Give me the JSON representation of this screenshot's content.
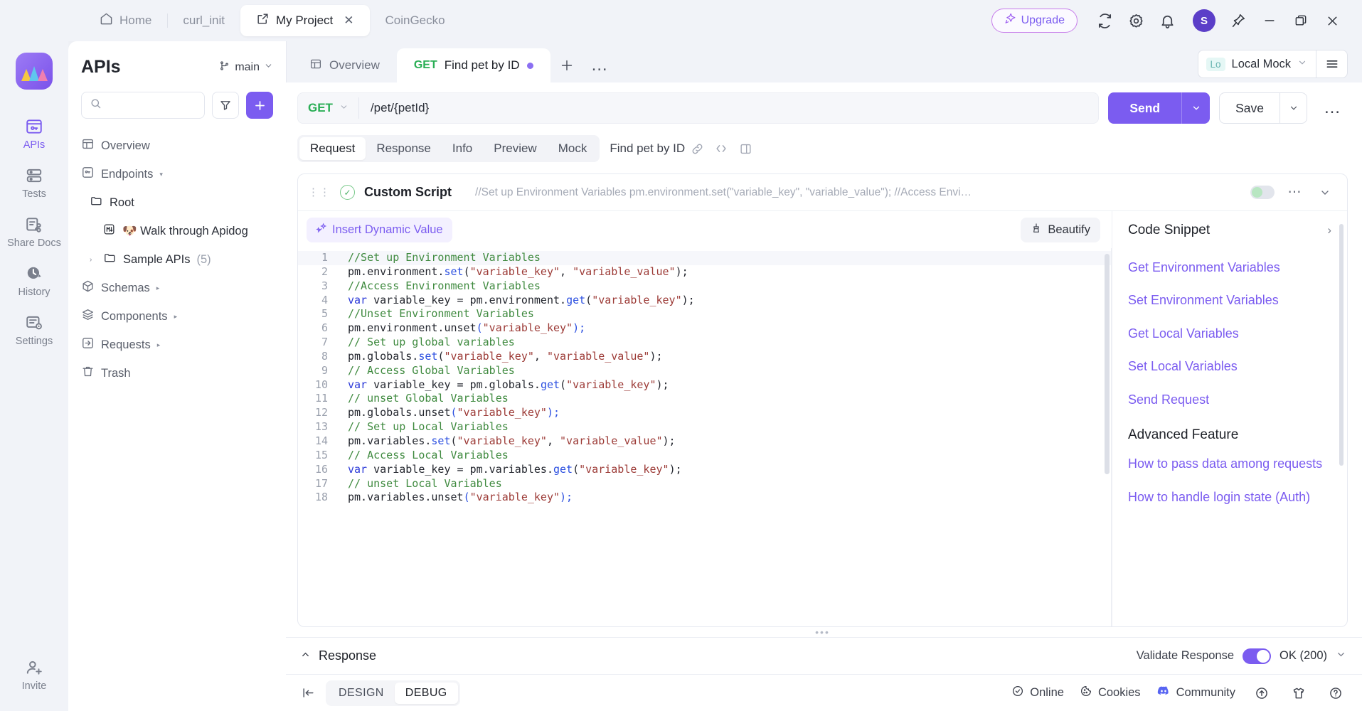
{
  "window": {
    "tabs": [
      {
        "label": "Home",
        "icon": "home-icon",
        "active": false
      },
      {
        "label": "curl_init",
        "icon": "",
        "active": false
      },
      {
        "label": "My Project",
        "icon": "external-link-icon",
        "active": true,
        "close": "✕"
      },
      {
        "label": "CoinGecko",
        "icon": "",
        "active": false
      }
    ],
    "upgrade_label": "Upgrade",
    "avatar_initial": "S",
    "controls": {
      "minimize": "—",
      "maximize": "restore-icon",
      "close": "✕"
    }
  },
  "rail": {
    "items": [
      {
        "label": "APIs",
        "icon": "apis-icon",
        "active": true
      },
      {
        "label": "Tests",
        "icon": "tests-icon",
        "active": false
      },
      {
        "label": "Share Docs",
        "icon": "share-docs-icon",
        "active": false
      },
      {
        "label": "History",
        "icon": "history-icon",
        "active": false
      },
      {
        "label": "Settings",
        "icon": "settings-icon",
        "active": false
      },
      {
        "label": "Invite",
        "icon": "invite-icon",
        "active": false
      }
    ],
    "watermark": "Apidog"
  },
  "sidebar": {
    "title": "APIs",
    "branch": "main",
    "search_placeholder": "",
    "filter_icon": "filter-icon",
    "add_label": "+",
    "tree": [
      {
        "label": "Overview",
        "icon": "overview-icon",
        "level": 0,
        "caret": "",
        "count": "",
        "tri": ""
      },
      {
        "label": "Endpoints",
        "icon": "endpoints-icon",
        "level": 0,
        "caret": "",
        "count": "",
        "tri": "▾"
      },
      {
        "label": "Root",
        "icon": "folder-icon",
        "level": 1,
        "caret": "",
        "count": "",
        "tri": ""
      },
      {
        "label": "🐶 Walk through Apidog",
        "icon": "markdown-icon",
        "level": 2,
        "caret": "",
        "count": "",
        "tri": ""
      },
      {
        "label": "Sample APIs",
        "icon": "folder-icon",
        "level": 1,
        "caret": "›",
        "count": "(5)",
        "tri": ""
      },
      {
        "label": "Schemas",
        "icon": "schemas-icon",
        "level": 0,
        "caret": "",
        "count": "",
        "tri": "▸"
      },
      {
        "label": "Components",
        "icon": "components-icon",
        "level": 0,
        "caret": "",
        "count": "",
        "tri": "▸"
      },
      {
        "label": "Requests",
        "icon": "requests-icon",
        "level": 0,
        "caret": "",
        "count": "",
        "tri": "▸"
      },
      {
        "label": "Trash",
        "icon": "trash-icon",
        "level": 0,
        "caret": "",
        "count": "",
        "tri": ""
      }
    ]
  },
  "main_tabs": {
    "overview_label": "Overview",
    "request_tab": {
      "method": "GET",
      "label": "Find pet by ID",
      "modified": true
    },
    "plus_label": "＋",
    "more_label": "…"
  },
  "environment": {
    "badge": "Lo",
    "name": "Local Mock",
    "hamburger_icon": "hamburger-icon"
  },
  "url_row": {
    "method": "GET",
    "path": "/pet/{petId}",
    "send_label": "Send",
    "save_label": "Save",
    "more_label": "…"
  },
  "subtabs": {
    "items": [
      {
        "label": "Request",
        "active": true
      },
      {
        "label": "Response",
        "active": false
      },
      {
        "label": "Info",
        "active": false
      },
      {
        "label": "Preview",
        "active": false
      },
      {
        "label": "Mock",
        "active": false
      }
    ],
    "endpoint_name": "Find pet by ID",
    "icons": [
      "link-icon",
      "code-icon",
      "split-view-icon"
    ]
  },
  "script": {
    "name": "Custom Script",
    "preview": "//Set up Environment Variables pm.environment.set(\"variable_key\", \"variable_value\"); //Access Envi…",
    "enabled_toggle": "off",
    "insert_dynamic_value": "Insert Dynamic Value",
    "beautify": "Beautify",
    "lines": [
      {
        "n": 1,
        "tokens": [
          {
            "t": "//Set up Environment Variables",
            "c": "cm"
          }
        ]
      },
      {
        "n": 2,
        "tokens": [
          {
            "t": "pm.environment.",
            "c": "cpl"
          },
          {
            "t": "set",
            "c": "cfn"
          },
          {
            "t": "(",
            "c": "cpl"
          },
          {
            "t": "\"variable_key\"",
            "c": "cstr"
          },
          {
            "t": ", ",
            "c": "cpl"
          },
          {
            "t": "\"variable_value\"",
            "c": "cstr"
          },
          {
            "t": ");",
            "c": "cpl"
          }
        ]
      },
      {
        "n": 3,
        "tokens": [
          {
            "t": "//Access Environment Variables",
            "c": "cm"
          }
        ]
      },
      {
        "n": 4,
        "tokens": [
          {
            "t": "var",
            "c": "ckw"
          },
          {
            "t": " variable_key = pm.environment.",
            "c": "cpl"
          },
          {
            "t": "get",
            "c": "cfn"
          },
          {
            "t": "(",
            "c": "cpl"
          },
          {
            "t": "\"variable_key\"",
            "c": "cstr"
          },
          {
            "t": ");",
            "c": "cpl"
          }
        ]
      },
      {
        "n": 5,
        "tokens": [
          {
            "t": "//Unset Environment Variables",
            "c": "cm"
          }
        ]
      },
      {
        "n": 6,
        "tokens": [
          {
            "t": "pm.environment.",
            "c": "cpl"
          },
          {
            "t": "unset",
            "c": "cpl"
          },
          {
            "t": "(",
            "c": "cfn"
          },
          {
            "t": "\"variable_key\"",
            "c": "cstr"
          },
          {
            "t": ");",
            "c": "cfn"
          }
        ]
      },
      {
        "n": 7,
        "tokens": [
          {
            "t": "// Set up global variables",
            "c": "cm"
          }
        ]
      },
      {
        "n": 8,
        "tokens": [
          {
            "t": "pm.globals.",
            "c": "cpl"
          },
          {
            "t": "set",
            "c": "cfn"
          },
          {
            "t": "(",
            "c": "cpl"
          },
          {
            "t": "\"variable_key\"",
            "c": "cstr"
          },
          {
            "t": ", ",
            "c": "cpl"
          },
          {
            "t": "\"variable_value\"",
            "c": "cstr"
          },
          {
            "t": ");",
            "c": "cpl"
          }
        ]
      },
      {
        "n": 9,
        "tokens": [
          {
            "t": "// Access Global Variables",
            "c": "cm"
          }
        ]
      },
      {
        "n": 10,
        "tokens": [
          {
            "t": "var",
            "c": "ckw"
          },
          {
            "t": " variable_key = pm.globals.",
            "c": "cpl"
          },
          {
            "t": "get",
            "c": "cfn"
          },
          {
            "t": "(",
            "c": "cpl"
          },
          {
            "t": "\"variable_key\"",
            "c": "cstr"
          },
          {
            "t": ");",
            "c": "cpl"
          }
        ]
      },
      {
        "n": 11,
        "tokens": [
          {
            "t": "// unset Global Variables",
            "c": "cm"
          }
        ]
      },
      {
        "n": 12,
        "tokens": [
          {
            "t": "pm.globals.",
            "c": "cpl"
          },
          {
            "t": "unset",
            "c": "cpl"
          },
          {
            "t": "(",
            "c": "cfn"
          },
          {
            "t": "\"variable_key\"",
            "c": "cstr"
          },
          {
            "t": ");",
            "c": "cfn"
          }
        ]
      },
      {
        "n": 13,
        "tokens": [
          {
            "t": "// Set up Local Variables",
            "c": "cm"
          }
        ]
      },
      {
        "n": 14,
        "tokens": [
          {
            "t": "pm.variables.",
            "c": "cpl"
          },
          {
            "t": "set",
            "c": "cfn"
          },
          {
            "t": "(",
            "c": "cpl"
          },
          {
            "t": "\"variable_key\"",
            "c": "cstr"
          },
          {
            "t": ", ",
            "c": "cpl"
          },
          {
            "t": "\"variable_value\"",
            "c": "cstr"
          },
          {
            "t": ");",
            "c": "cpl"
          }
        ]
      },
      {
        "n": 15,
        "tokens": [
          {
            "t": "// Access Local Variables",
            "c": "cm"
          }
        ]
      },
      {
        "n": 16,
        "tokens": [
          {
            "t": "var",
            "c": "ckw"
          },
          {
            "t": " variable_key = pm.variables.",
            "c": "cpl"
          },
          {
            "t": "get",
            "c": "cfn"
          },
          {
            "t": "(",
            "c": "cpl"
          },
          {
            "t": "\"variable_key\"",
            "c": "cstr"
          },
          {
            "t": ");",
            "c": "cpl"
          }
        ]
      },
      {
        "n": 17,
        "tokens": [
          {
            "t": "// unset Local Variables",
            "c": "cm"
          }
        ]
      },
      {
        "n": 18,
        "tokens": [
          {
            "t": "pm.variables.",
            "c": "cpl"
          },
          {
            "t": "unset",
            "c": "cpl"
          },
          {
            "t": "(",
            "c": "cfn"
          },
          {
            "t": "\"variable_key\"",
            "c": "cstr"
          },
          {
            "t": ");",
            "c": "cfn"
          }
        ]
      }
    ]
  },
  "snippet_panel": {
    "title": "Code Snippet",
    "expand_icon": "chevron-right-icon",
    "links": [
      "Get Environment Variables",
      "Set Environment Variables",
      "Get Local Variables",
      "Set Local Variables",
      "Send Request"
    ],
    "group_title": "Advanced Feature",
    "advanced_links": [
      "How to pass data among requests",
      "How to handle login state (Auth)"
    ]
  },
  "response_bar": {
    "collapse_icon": "chevron-up-icon",
    "label": "Response",
    "validate_label": "Validate Response",
    "validate_on": true,
    "status": "OK (200)"
  },
  "statusbar": {
    "collapse_icon": "collapse-left-icon",
    "modes": [
      {
        "label": "DESIGN",
        "active": false
      },
      {
        "label": "DEBUG",
        "active": true
      }
    ],
    "items": [
      {
        "label": "Online",
        "icon": "online-icon"
      },
      {
        "label": "Cookies",
        "icon": "cookie-icon"
      },
      {
        "label": "Community",
        "icon": "discord-icon"
      }
    ],
    "trailing_icons": [
      "upload-icon",
      "shirt-icon",
      "help-icon"
    ]
  },
  "colors": {
    "accent": "#7b5cf0",
    "method_get": "#2aae55",
    "comment": "#3f8a3f",
    "string": "#9c3a36",
    "keyword": "#2b39d8"
  }
}
